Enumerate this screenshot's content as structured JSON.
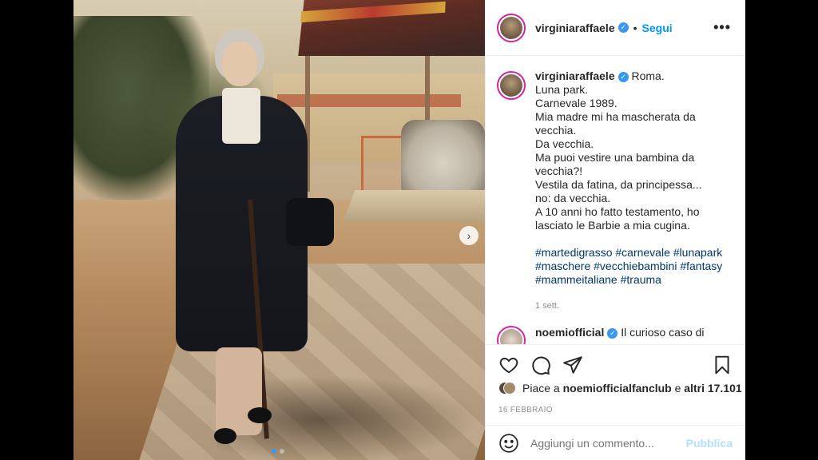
{
  "post": {
    "username": "virginiaraffaele",
    "follow_label": "Segui",
    "more_label": "•••",
    "caption_lines": [
      "Roma.",
      "Luna park.",
      "Carnevale 1989.",
      "Mia madre mi ha mascherata da",
      "vecchia.",
      "Da vecchia.",
      "Ma puoi vestire una bambina da",
      "vecchia?!",
      "Vestila da fatina, da principessa...",
      "no: da vecchia.",
      "A 10 anni ho fatto testamento, ho",
      "lasciato le Barbie a mia cugina."
    ],
    "hashtag_lines": [
      "#martedigrasso #carnevale #lunapark",
      "#maschere #vecchiebambini #fantasy",
      "#mammeitaliane #trauma"
    ],
    "time_ago": "1 sett.",
    "comment": {
      "username": "noemiofficial",
      "text": "Il curioso caso di"
    },
    "likes_prefix": "Piace a ",
    "likes_user": "noemiofficialfanclub",
    "likes_middle": " e ",
    "likes_others": "altri 17.101",
    "date": "16 FEBBRAIO",
    "comment_placeholder": "Aggiungi un commento...",
    "publish_label": "Pubblica"
  },
  "icons": {
    "verified": "verified-badge-icon",
    "next": "chevron-right-icon",
    "like": "heart-icon",
    "comment": "comment-icon",
    "share": "paper-plane-icon",
    "save": "bookmark-icon",
    "emoji": "smiley-icon"
  },
  "colors": {
    "accent": "#0095f6",
    "link": "#00376b",
    "muted": "#8e8e8e",
    "publish_disabled": "#b2dffc",
    "verified": "#3897f0"
  },
  "carousel": {
    "count": 2,
    "active": 1
  }
}
